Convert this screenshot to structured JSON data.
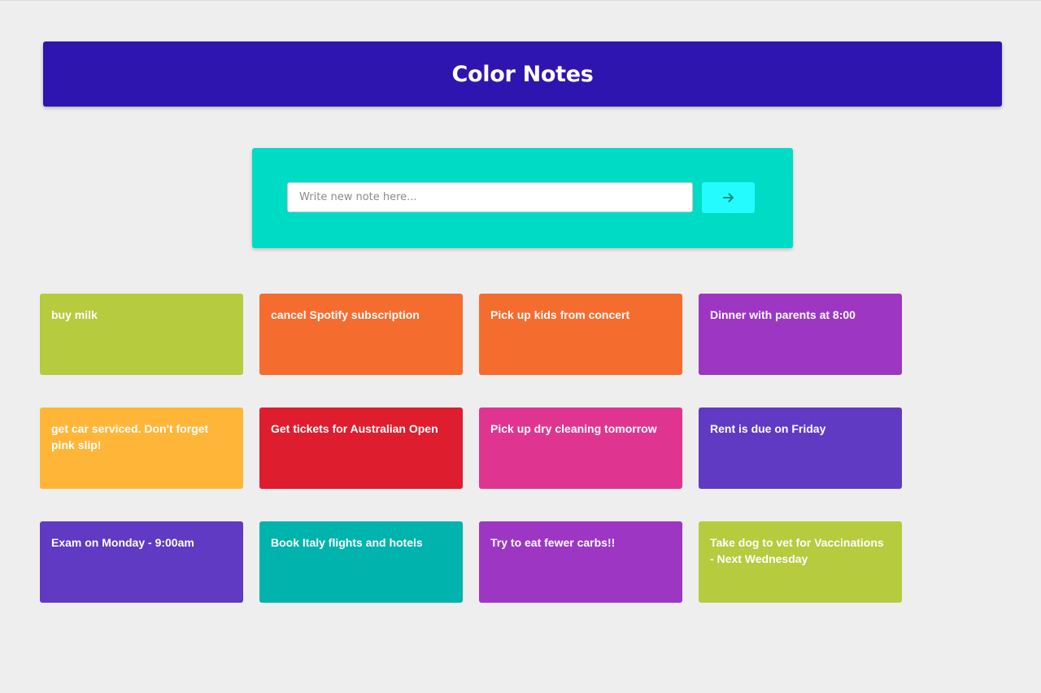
{
  "header": {
    "title": "Color Notes",
    "background": "#2e15af"
  },
  "composer": {
    "background": "#00dbc6",
    "input": {
      "value": "",
      "placeholder": "Write new note here..."
    },
    "submit_button": {
      "icon": "arrow-right-icon",
      "background": "#23fbff",
      "icon_color": "#0d8a80"
    }
  },
  "notes": [
    {
      "text": "buy milk",
      "color": "#b6cb3e"
    },
    {
      "text": "cancel Spotify subscription",
      "color": "#f56c2f"
    },
    {
      "text": "Pick up kids from concert",
      "color": "#f56c2f"
    },
    {
      "text": "Dinner with parents at 8:00",
      "color": "#9d36c3"
    },
    {
      "text": "get car serviced. Don't forget pink slip!",
      "color": "#ffb638"
    },
    {
      "text": "Get tickets for Australian Open",
      "color": "#de1d2f"
    },
    {
      "text": "Pick up dry cleaning tomorrow",
      "color": "#df3590"
    },
    {
      "text": "Rent is due on Friday",
      "color": "#603ac2"
    },
    {
      "text": "Exam on Monday - 9:00am",
      "color": "#603ac2"
    },
    {
      "text": "Book Italy flights and hotels",
      "color": "#00b3ad"
    },
    {
      "text": "Try to eat fewer carbs!!",
      "color": "#9d36c3"
    },
    {
      "text": "Take dog to vet for Vaccinations - Next Wednesday",
      "color": "#b6cb3e"
    }
  ]
}
